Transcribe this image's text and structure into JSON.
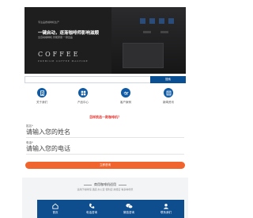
{
  "hero": {
    "top_small": "专注品质咖啡机生产",
    "headline": "一键启动，逐渐咖啡师影响滋顺",
    "sub": "全自动咖啡机 智能研磨 一键出品",
    "brand": "COFFEE",
    "brand_sub": "PREMIUM COFFEE MACHINE"
  },
  "search": {
    "placeholder": "",
    "button_label": "搜索"
  },
  "categories": [
    {
      "label": "关于我们",
      "icon": "building-icon"
    },
    {
      "label": "产品中心",
      "icon": "grid-icon"
    },
    {
      "label": "客户案例",
      "icon": "handshake-icon"
    },
    {
      "label": "新闻资讯",
      "icon": "news-icon"
    }
  ],
  "form": {
    "question": "怎样挑选一款咖啡机？",
    "name_label": "姓名*",
    "name_placeholder": "请输入您的姓名",
    "phone_label": "电话*",
    "phone_placeholder": "请输入您的电话",
    "submit_label": "立即咨询"
  },
  "section": {
    "title": "商用咖啡机适用",
    "subtitle": "适用于咖啡馆 酒店 办公室 便利店 烘焙店 等多种场景"
  },
  "bottom_nav": [
    {
      "label": "首页",
      "icon": "home-icon"
    },
    {
      "label": "电话咨询",
      "icon": "phone-icon"
    },
    {
      "label": "微信咨询",
      "icon": "wechat-icon"
    },
    {
      "label": "联系我们",
      "icon": "contact-icon"
    }
  ],
  "colors": {
    "primary": "#0e5aa7",
    "nav_bg": "#0e4e8f",
    "accent": "#f0642e",
    "question": "#e53935"
  }
}
